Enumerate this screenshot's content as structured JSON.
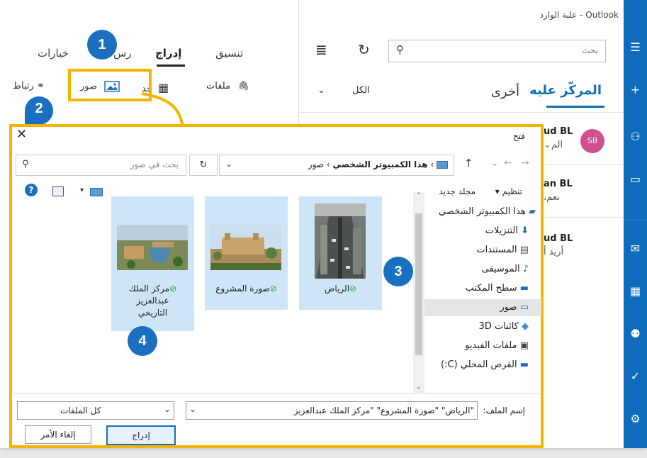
{
  "window": {
    "title": "علبة الوارد - Outlook"
  },
  "search": {
    "placeholder": "بحث"
  },
  "inbox": {
    "tab_focused": "المركّز عليه",
    "tab_other": "أخرى",
    "filter": "الكل",
    "messages": [
      {
        "avatar": "SB",
        "sender": "ud BL",
        "preview": "الم"
      },
      {
        "sender": "an BL",
        "preview": "نعم،"
      },
      {
        "sender": "ud BL",
        "preview": "أريد أ"
      }
    ]
  },
  "compose": {
    "tabs": [
      "تنسيق",
      "إدراج",
      "رسم",
      "خيارات"
    ],
    "tab_draw_partial": "رس",
    "ribbon": {
      "files": "ملفات",
      "table": "جدول",
      "table_partial": "جد",
      "pictures": "صور",
      "link": "ارتباط",
      "link_partial": "رتباط"
    }
  },
  "callouts": [
    "1",
    "2",
    "3",
    "4"
  ],
  "dialog": {
    "title": "فتح",
    "path": [
      "هذا الكمبيوتر الشخصي",
      "صور"
    ],
    "search_placeholder": "بحث في صور",
    "organize": "تنظيم",
    "new_folder": "مجلد جديد",
    "tree": [
      "هذا الكمبيوتر الشخصي",
      "التنزيلات",
      "المستندات",
      "الموسيقى",
      "سطح المكتب",
      "صور",
      "كائنات 3D",
      "ملفات الفيديو",
      "القرص المحلي (C:)"
    ],
    "tree_selected_index": 5,
    "files": [
      {
        "name": "الرياض"
      },
      {
        "name": "صورة المشروع"
      },
      {
        "name_lines": [
          "مركز الملك",
          "عبدالعزيز",
          "التاريخي"
        ]
      }
    ],
    "filename_label": "إسم الملف:",
    "filename_value": "\"الرياض\" \"صورة المشروع\" \"مركز الملك عبدالعزيز",
    "filetype": "كل الملفات",
    "insert_button": "إدراج",
    "cancel_button": "إلغاء الأمر"
  },
  "colors": {
    "accent": "#0f6cbd",
    "highlight": "#f4b400",
    "badge": "#1a6fc1",
    "selection": "#cde5f7"
  }
}
